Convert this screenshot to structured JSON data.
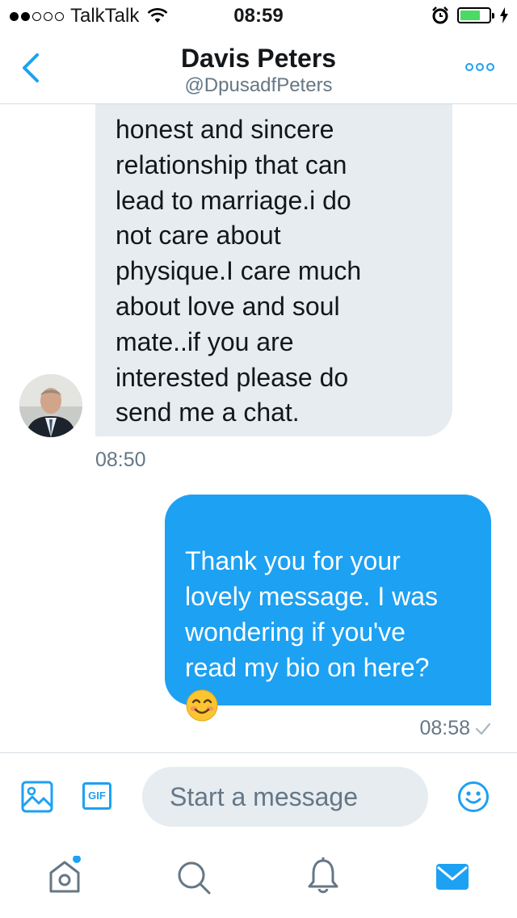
{
  "status_bar": {
    "carrier": "TalkTalk",
    "time": "08:59",
    "signal_bars_filled": 2,
    "signal_bars_total": 5,
    "battery_level": 0.7,
    "battery_color": "#4cd964"
  },
  "header": {
    "name": "Davis Peters",
    "handle": "@DpusadfPeters",
    "back_icon": "chevron-left-icon",
    "more_icon": "more-dots-icon"
  },
  "messages": [
    {
      "direction": "incoming",
      "text": "honest and sincere\nrelationship that can\nlead to marriage.i do\nnot care about\nphysique.I care much\nabout love and soul\nmate..if you are\ninterested please do\nsend me a chat.",
      "time": "08:50"
    },
    {
      "direction": "outgoing",
      "text": "Thank you for your\nlovely message. I was\nwondering if you've\nread my bio on here?",
      "emoji": "smiling-face-emoji",
      "time": "08:58",
      "status_icon": "check-icon"
    }
  ],
  "composer": {
    "placeholder": "Start a message",
    "gif_label": "GIF"
  },
  "tabs": [
    {
      "name": "home",
      "icon": "home-icon",
      "badge": true
    },
    {
      "name": "search",
      "icon": "search-icon",
      "badge": false
    },
    {
      "name": "notifications",
      "icon": "bell-icon",
      "badge": false
    },
    {
      "name": "messages",
      "icon": "envelope-icon",
      "active": true
    }
  ],
  "colors": {
    "accent": "#1da1f2",
    "incoming_bubble": "#e6ecf0",
    "secondary_text": "#657786"
  }
}
